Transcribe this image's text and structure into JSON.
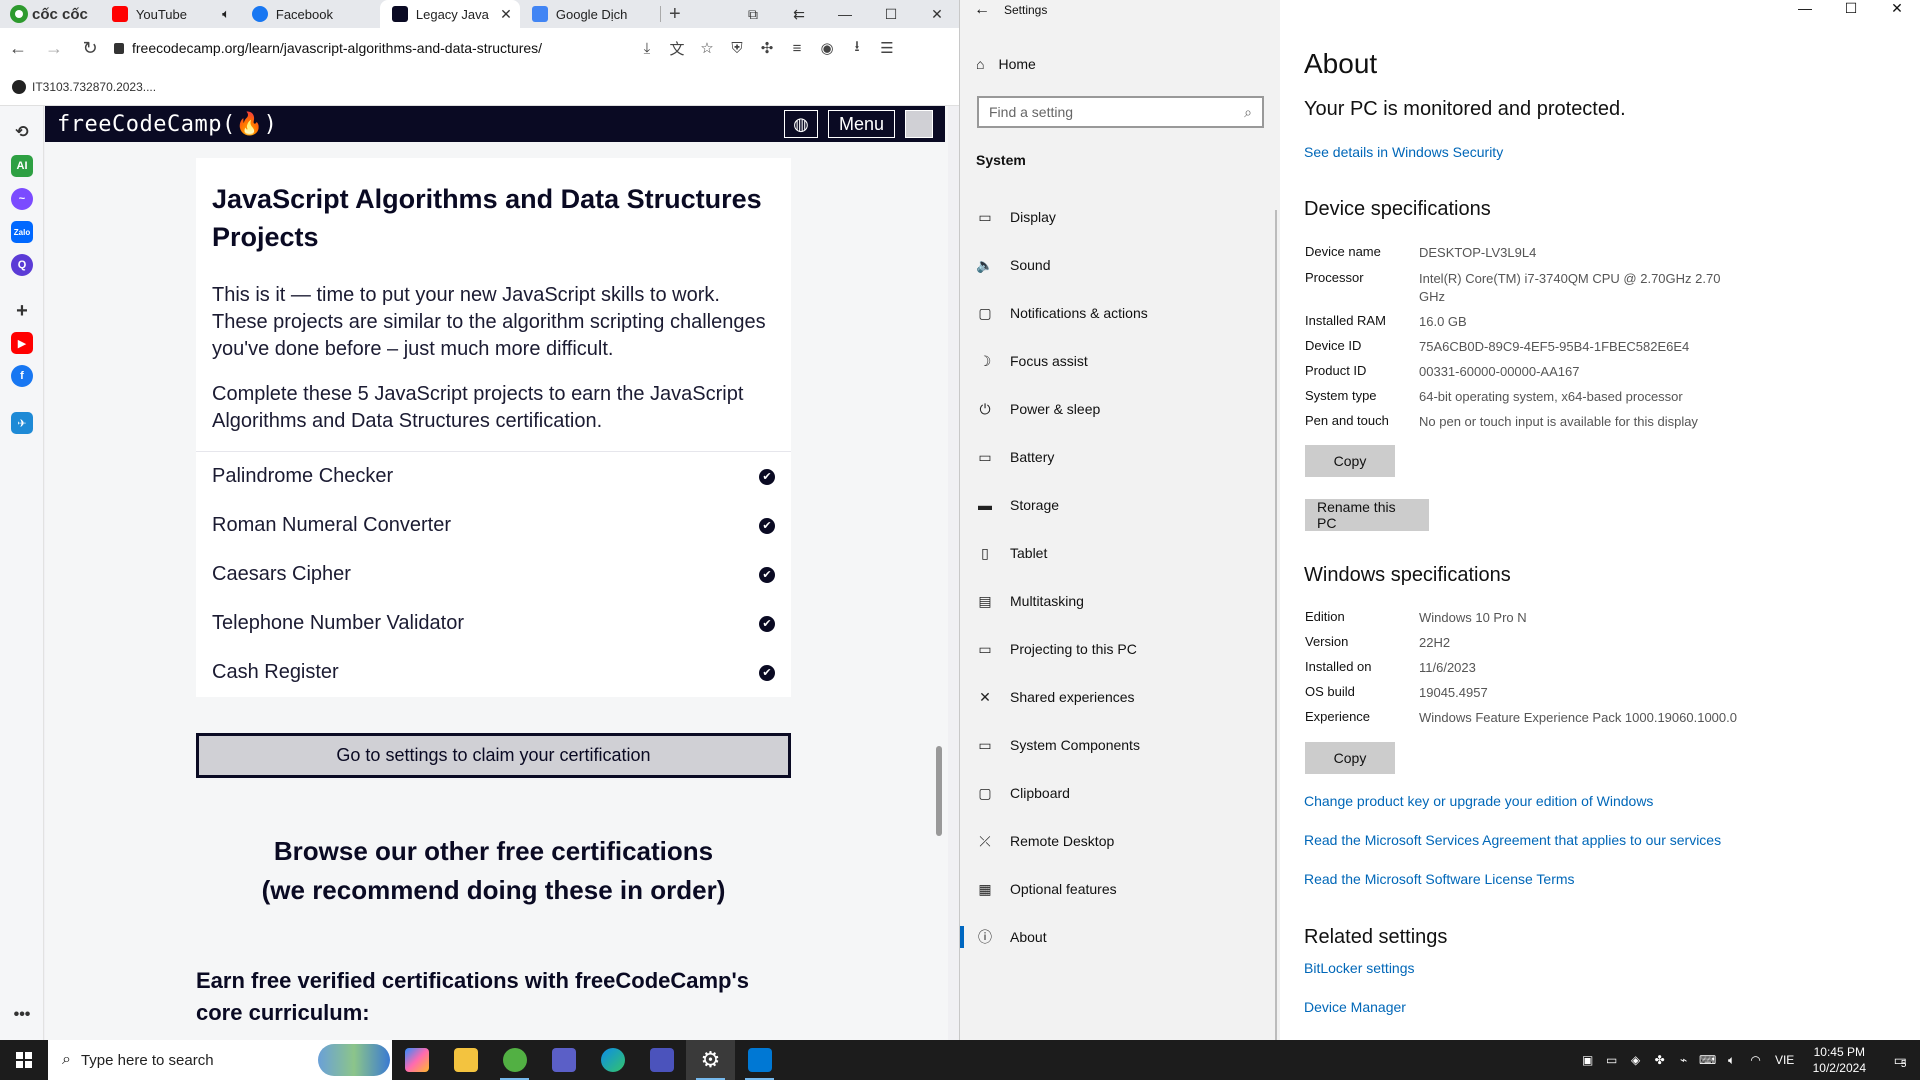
{
  "browser": {
    "brand": "cốc cốc",
    "tabs": [
      {
        "title": "YouTube",
        "color": "#ff0000"
      },
      {
        "title": "Facebook",
        "color": "#1877f2"
      },
      {
        "title": "Legacy Java",
        "color": "#0a0a23"
      },
      {
        "title": "Google Dịch",
        "color": "#4285f4"
      }
    ],
    "url": "freecodecamp.org/learn/javascript-algorithms-and-data-structures/",
    "bookmark": "IT3103.732870.2023...."
  },
  "fcc": {
    "logo": "freeCodeCamp(🔥)",
    "menu_label": "Menu",
    "title": "JavaScript Algorithms and Data Structures Projects",
    "intro": "This is it — time to put your new JavaScript skills to work. These projects are similar to the algorithm scripting challenges you've done before – just much more difficult.",
    "complete": "Complete these 5 JavaScript projects to earn the JavaScript Algorithms and Data Structures certification.",
    "projects": [
      "Palindrome Checker",
      "Roman Numeral Converter",
      "Caesars Cipher",
      "Telephone Number Validator",
      "Cash Register"
    ],
    "claim_button": "Go to settings to claim your certification",
    "browse_line1": "Browse our other free certifications",
    "browse_line2": "(we recommend doing these in order)",
    "earn": "Earn free verified certifications with freeCodeCamp's core curriculum:"
  },
  "settings": {
    "window_title": "Settings",
    "home": "Home",
    "search_placeholder": "Find a setting",
    "section": "System",
    "nav": [
      {
        "label": "Display",
        "icon": "display-icon",
        "glyph": "▭"
      },
      {
        "label": "Sound",
        "icon": "sound-icon",
        "glyph": "🔈"
      },
      {
        "label": "Notifications & actions",
        "icon": "notifications-icon",
        "glyph": "▢"
      },
      {
        "label": "Focus assist",
        "icon": "focus-assist-icon",
        "glyph": "☽"
      },
      {
        "label": "Power & sleep",
        "icon": "power-icon",
        "glyph": "⏻"
      },
      {
        "label": "Battery",
        "icon": "battery-icon",
        "glyph": "▭"
      },
      {
        "label": "Storage",
        "icon": "storage-icon",
        "glyph": "▬"
      },
      {
        "label": "Tablet",
        "icon": "tablet-icon",
        "glyph": "▯"
      },
      {
        "label": "Multitasking",
        "icon": "multitasking-icon",
        "glyph": "▤"
      },
      {
        "label": "Projecting to this PC",
        "icon": "projecting-icon",
        "glyph": "▭"
      },
      {
        "label": "Shared experiences",
        "icon": "shared-experiences-icon",
        "glyph": "✕"
      },
      {
        "label": "System Components",
        "icon": "system-components-icon",
        "glyph": "▭"
      },
      {
        "label": "Clipboard",
        "icon": "clipboard-icon",
        "glyph": "▢"
      },
      {
        "label": "Remote Desktop",
        "icon": "remote-desktop-icon",
        "glyph": "⤫"
      },
      {
        "label": "Optional features",
        "icon": "optional-features-icon",
        "glyph": "▦"
      },
      {
        "label": "About",
        "icon": "about-icon",
        "glyph": "ⓘ"
      }
    ],
    "about": {
      "title": "About",
      "protected": "Your PC is monitored and protected.",
      "security_link": "See details in Windows Security",
      "device_specs_title": "Device specifications",
      "device_specs": [
        {
          "k": "Device name",
          "v": "DESKTOP-LV3L9L4"
        },
        {
          "k": "Processor",
          "v": "Intel(R) Core(TM) i7-3740QM CPU @ 2.70GHz   2.70 GHz"
        },
        {
          "k": "Installed RAM",
          "v": "16.0 GB"
        },
        {
          "k": "Device ID",
          "v": "75A6CB0D-89C9-4EF5-95B4-1FBEC582E6E4"
        },
        {
          "k": "Product ID",
          "v": "00331-60000-00000-AA167"
        },
        {
          "k": "System type",
          "v": "64-bit operating system, x64-based processor"
        },
        {
          "k": "Pen and touch",
          "v": "No pen or touch input is available for this display"
        }
      ],
      "copy_label": "Copy",
      "rename_label": "Rename this PC",
      "windows_specs_title": "Windows specifications",
      "windows_specs": [
        {
          "k": "Edition",
          "v": "Windows 10 Pro N"
        },
        {
          "k": "Version",
          "v": "22H2"
        },
        {
          "k": "Installed on",
          "v": "11/6/2023"
        },
        {
          "k": "OS build",
          "v": "19045.4957"
        },
        {
          "k": "Experience",
          "v": "Windows Feature Experience Pack 1000.19060.1000.0"
        }
      ],
      "links": [
        "Change product key or upgrade your edition of Windows",
        "Read the Microsoft Services Agreement that applies to our services",
        "Read the Microsoft Software License Terms"
      ],
      "related_title": "Related settings",
      "related_links": [
        "BitLocker settings",
        "Device Manager"
      ]
    }
  },
  "taskbar": {
    "search_placeholder": "Type here to search",
    "language": "VIE",
    "time": "10:45 PM",
    "date": "10/2/2024",
    "notification_count": "5"
  }
}
